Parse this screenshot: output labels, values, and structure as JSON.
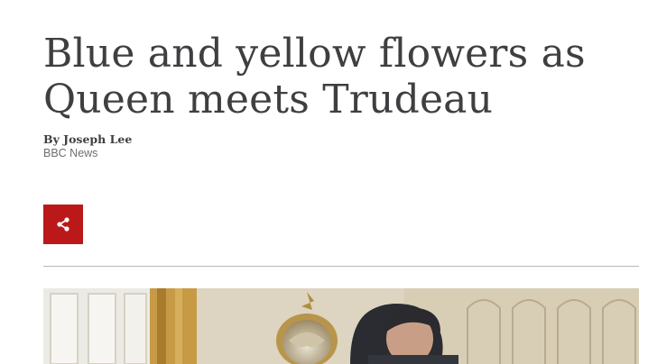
{
  "article": {
    "headline": "Blue and yellow flowers as Queen meets Trudeau",
    "byline": "By Joseph Lee",
    "source": "BBC News"
  },
  "share": {
    "icon": "share-icon",
    "color": "#bb1919"
  },
  "colors": {
    "text": "#3f3f42",
    "muted": "#6e6e73",
    "divider": "#b9b9bc"
  }
}
